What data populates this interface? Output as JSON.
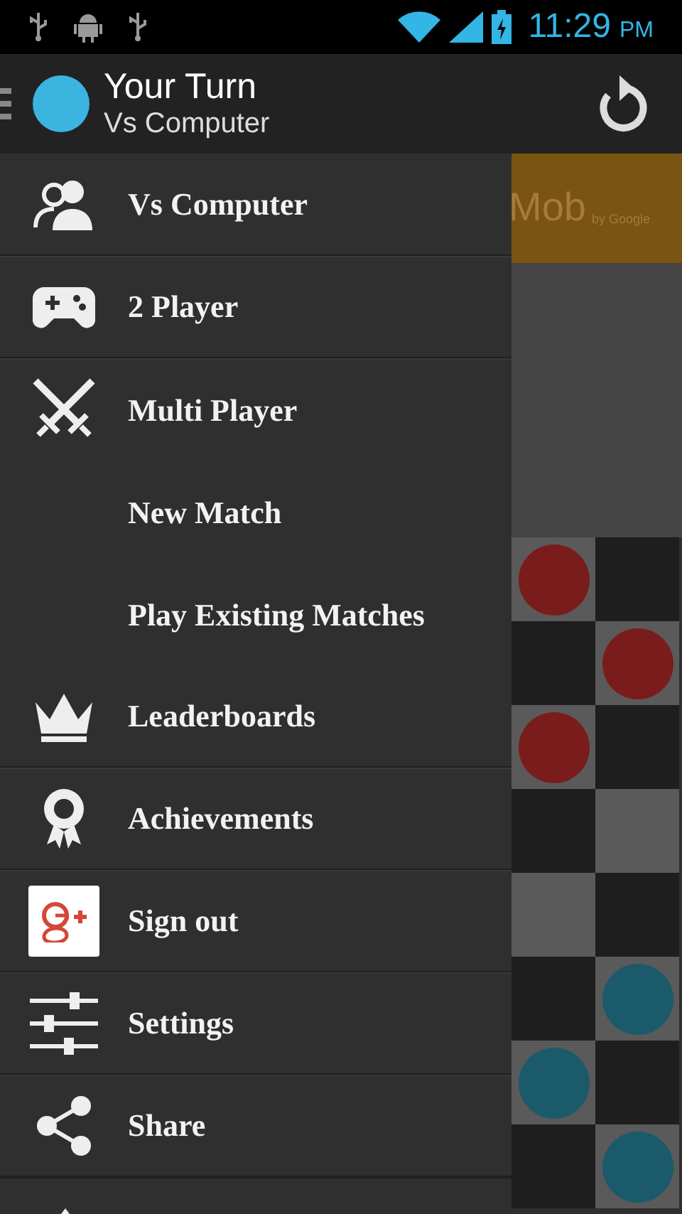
{
  "status_bar": {
    "time": "11:29",
    "ampm": "PM"
  },
  "action_bar": {
    "title": "Your Turn",
    "subtitle": "Vs Computer"
  },
  "ad_banner": {
    "text": "Mob",
    "byline": "by Google"
  },
  "board": {
    "rows": [
      {
        "cells": [
          {
            "occupied": true,
            "color": "#7a1c1c"
          },
          {
            "occupied": false
          }
        ]
      },
      {
        "cells": [
          {
            "occupied": false
          },
          {
            "occupied": true,
            "color": "#7a1c1c"
          }
        ]
      },
      {
        "cells": [
          {
            "occupied": true,
            "color": "#7a1c1c"
          },
          {
            "occupied": false
          }
        ]
      },
      {
        "cells": [
          {
            "occupied": false
          },
          {
            "occupied": false
          }
        ]
      },
      {
        "cells": [
          {
            "occupied": false
          },
          {
            "occupied": false
          }
        ]
      },
      {
        "cells": [
          {
            "occupied": false
          },
          {
            "occupied": true,
            "color": "#1b5a6a"
          }
        ]
      },
      {
        "cells": [
          {
            "occupied": true,
            "color": "#1b5a6a"
          },
          {
            "occupied": false
          }
        ]
      },
      {
        "cells": [
          {
            "occupied": false
          },
          {
            "occupied": true,
            "color": "#1b5a6a"
          }
        ]
      }
    ]
  },
  "drawer": {
    "items": [
      {
        "kind": "icon",
        "label": "Vs Computer"
      },
      {
        "kind": "icon",
        "label": "2 Player"
      },
      {
        "kind": "icon",
        "label": "Multi Player"
      },
      {
        "kind": "sub",
        "label": "New Match"
      },
      {
        "kind": "sub",
        "label": "Play Existing Matches"
      },
      {
        "kind": "icon",
        "label": "Leaderboards"
      },
      {
        "kind": "icon",
        "label": "Achievements"
      },
      {
        "kind": "icon",
        "label": "Sign out"
      },
      {
        "kind": "icon",
        "label": "Settings"
      },
      {
        "kind": "icon",
        "label": "Share"
      }
    ]
  }
}
